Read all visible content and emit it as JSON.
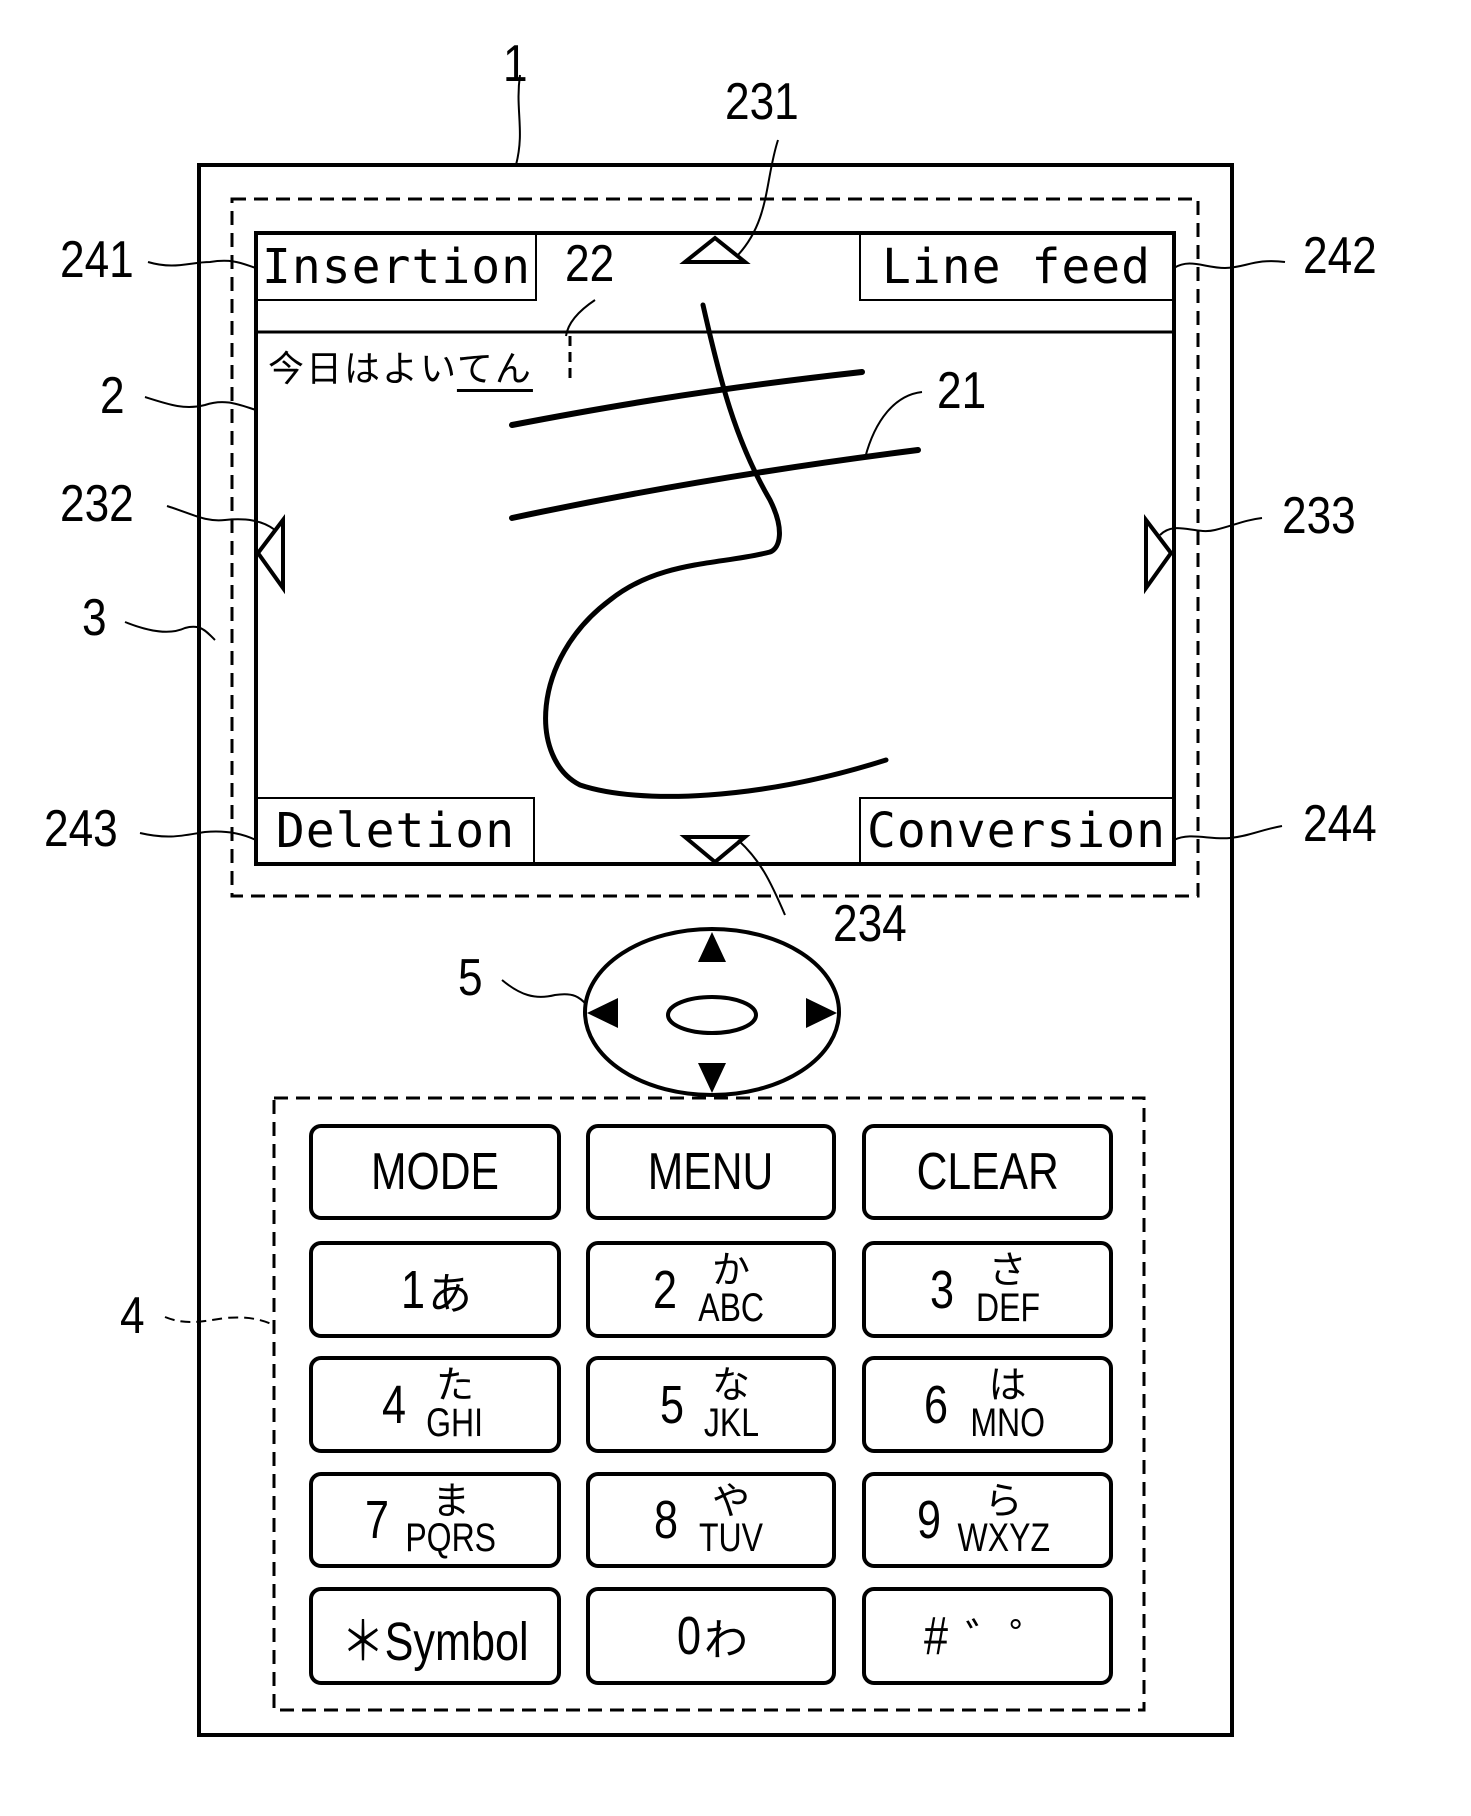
{
  "figure": {
    "type": "patent-drawing",
    "subject": "mobile phone with handwriting input screen"
  },
  "reference_labels": {
    "device": "1",
    "display_panel": "2",
    "display_region": "3",
    "keypad": "4",
    "cross_key": "5",
    "handwriting_area": "21",
    "text_cursor": "22",
    "scroll_up_arrow": "231",
    "scroll_left_arrow": "232",
    "scroll_right_arrow": "233",
    "scroll_down_arrow": "234",
    "insertion_softkey": "241",
    "line_feed_softkey": "242",
    "deletion_softkey": "243",
    "conversion_softkey": "244"
  },
  "screen": {
    "softkeys": {
      "top_left": "Insertion",
      "top_right": "Line feed",
      "bottom_left": "Deletion",
      "bottom_right": "Conversion"
    },
    "input_text": {
      "committed": "今日はよい",
      "pending": "てん"
    },
    "handwritten_character": "き"
  },
  "keypad": {
    "function_keys": [
      "MODE",
      "MENU",
      "CLEAR"
    ],
    "keys": [
      {
        "digit": "1",
        "kana": "あ",
        "latin": ""
      },
      {
        "digit": "2",
        "kana": "か",
        "latin": "ABC"
      },
      {
        "digit": "3",
        "kana": "さ",
        "latin": "DEF"
      },
      {
        "digit": "4",
        "kana": "た",
        "latin": "GHI"
      },
      {
        "digit": "5",
        "kana": "な",
        "latin": "JKL"
      },
      {
        "digit": "6",
        "kana": "は",
        "latin": "MNO"
      },
      {
        "digit": "7",
        "kana": "ま",
        "latin": "PQRS"
      },
      {
        "digit": "8",
        "kana": "や",
        "latin": "TUV"
      },
      {
        "digit": "9",
        "kana": "ら",
        "latin": "WXYZ"
      }
    ],
    "bottom_row": {
      "star": "＊Symbol",
      "zero_digit": "0",
      "zero_kana": "わ",
      "hash": "#",
      "hash_marks": "゛゜"
    }
  }
}
